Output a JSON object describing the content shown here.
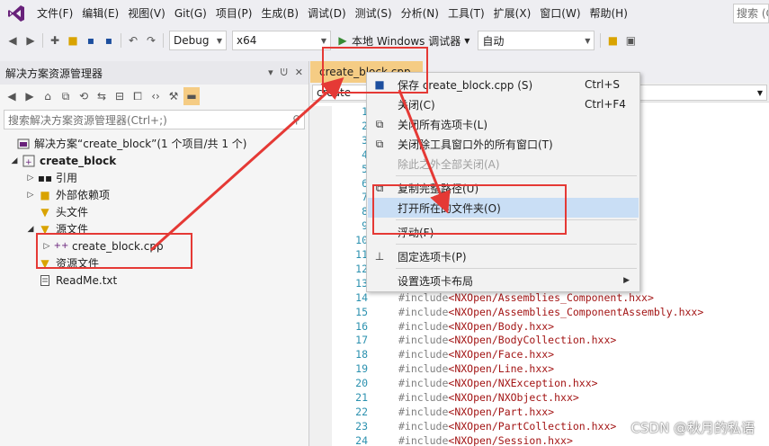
{
  "menubar": {
    "items": [
      "文件(F)",
      "编辑(E)",
      "视图(V)",
      "Git(G)",
      "项目(P)",
      "生成(B)",
      "调试(D)",
      "测试(S)",
      "分析(N)",
      "工具(T)",
      "扩展(X)",
      "窗口(W)",
      "帮助(H)"
    ],
    "search": "搜索 (C"
  },
  "toolbar": {
    "config": "Debug",
    "platform": "x64",
    "run_label": "本地 Windows 调试器",
    "auto": "自动"
  },
  "solution_explorer": {
    "title": "解决方案资源管理器",
    "search_placeholder": "搜索解决方案资源管理器(Ctrl+;)",
    "solution_label": "解决方案“create_block”(1 个项目/共 1 个)",
    "project": "create_block",
    "references": "引用",
    "external_deps": "外部依赖项",
    "header_files": "头文件",
    "source_files": "源文件",
    "cpp_file": "create_block.cpp",
    "resource_files": "资源文件",
    "readme": "ReadMe.txt"
  },
  "editor": {
    "tab_label": "create_block.cpp",
    "nav_scope": "create",
    "code_lines": [
      {
        "n": "1",
        "pre": "",
        "path": ""
      },
      {
        "n": "2",
        "pre": "",
        "path": ""
      },
      {
        "n": "3",
        "pre": "",
        "path": ""
      },
      {
        "n": "4",
        "pre": "",
        "path": ""
      },
      {
        "n": "5",
        "pre": "",
        "path": ""
      },
      {
        "n": "6",
        "pre": "",
        "path": ""
      },
      {
        "n": "7",
        "pre": "",
        "path": ""
      },
      {
        "n": "8",
        "pre": "",
        "path": ""
      },
      {
        "n": "9",
        "pre": "",
        "path": ""
      },
      {
        "n": "10",
        "pre": "",
        "path": ""
      },
      {
        "n": "11",
        "pre": "",
        "path": ""
      },
      {
        "n": "12",
        "pre": "",
        "path": ""
      },
      {
        "n": "13",
        "pre": "",
        "path": ""
      },
      {
        "n": "14",
        "pre": "#include ",
        "path": "<NXOpen/Assemblies_Component.hxx>"
      },
      {
        "n": "15",
        "pre": "#include ",
        "path": "<NXOpen/Assemblies_ComponentAssembly.hxx>"
      },
      {
        "n": "16",
        "pre": "#include ",
        "path": "<NXOpen/Body.hxx>"
      },
      {
        "n": "17",
        "pre": "#include ",
        "path": "<NXOpen/BodyCollection.hxx>"
      },
      {
        "n": "18",
        "pre": "#include ",
        "path": "<NXOpen/Face.hxx>"
      },
      {
        "n": "19",
        "pre": "#include ",
        "path": "<NXOpen/Line.hxx>"
      },
      {
        "n": "20",
        "pre": "#include ",
        "path": "<NXOpen/NXException.hxx>"
      },
      {
        "n": "21",
        "pre": "#include ",
        "path": "<NXOpen/NXObject.hxx>"
      },
      {
        "n": "22",
        "pre": "#include ",
        "path": "<NXOpen/Part.hxx>"
      },
      {
        "n": "23",
        "pre": "#include ",
        "path": "<NXOpen/PartCollection.hxx>"
      },
      {
        "n": "24",
        "pre": "#include ",
        "path": "<NXOpen/Session.hxx>"
      }
    ]
  },
  "context_menu": {
    "save": "保存 create_block.cpp (S)",
    "save_sc": "Ctrl+S",
    "close": "关闭(C)",
    "close_sc": "Ctrl+F4",
    "close_all": "关闭所有选项卡(L)",
    "close_all_but_tool": "关闭除工具窗口外的所有窗口(T)",
    "close_all_but_this": "除此之外全部关闭(A)",
    "copy_path": "复制完整路径(U)",
    "open_folder": "打开所在的文件夹(O)",
    "float": "浮动(F)",
    "pin": "固定选项卡(P)",
    "layout": "设置选项卡布局"
  },
  "watermark": "CSDN @秋月的私语",
  "colors": {
    "accent": "#68217a",
    "tab_active": "#f5cc84",
    "highlight": "#c9def5",
    "annotation": "#e53935"
  }
}
